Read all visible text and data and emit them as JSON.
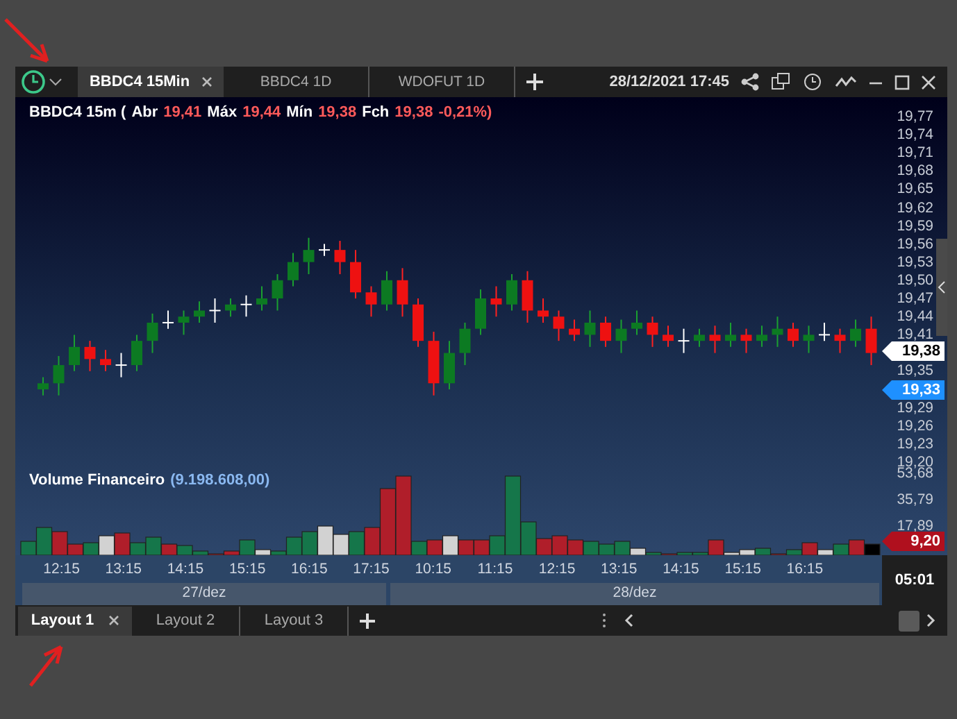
{
  "window": {
    "tabs": [
      {
        "label": "BBDC4 15Min",
        "selected": true
      },
      {
        "label": "BBDC4 1D",
        "selected": false
      },
      {
        "label": "WDOFUT 1D",
        "selected": false
      }
    ],
    "datetime": "28/12/2021 17:45"
  },
  "chart": {
    "legend": {
      "title": "BBDC4 15m (",
      "items": [
        {
          "label": "Abr",
          "value": "19,41"
        },
        {
          "label": "Máx",
          "value": "19,44"
        },
        {
          "label": "Mín",
          "value": "19,38"
        },
        {
          "label": "Fch",
          "value": "19,38"
        }
      ],
      "change": "-0,21%)"
    },
    "price_axis": [
      "19,77",
      "19,74",
      "19,71",
      "19,68",
      "19,65",
      "19,62",
      "19,59",
      "19,56",
      "19,53",
      "19,50",
      "19,47",
      "19,44",
      "19,41",
      "19,35",
      "19,29",
      "19,26",
      "19,23",
      "19,20"
    ],
    "last_price": "19,38",
    "bid_price": "19,33",
    "volume": {
      "title": "Volume Financeiro",
      "value": "(9.198.608,00)",
      "axis": [
        "53,68",
        "35,79",
        "17,89"
      ],
      "last": "9,20"
    },
    "time_labels": [
      "12:15",
      "13:15",
      "14:15",
      "15:15",
      "16:15",
      "17:15",
      "10:15",
      "11:15",
      "12:15",
      "13:15",
      "14:15",
      "15:15",
      "16:15"
    ],
    "dates": [
      "27/dez",
      "28/dez"
    ],
    "countdown": "05:01"
  },
  "layouts": [
    {
      "label": "Layout 1",
      "selected": true
    },
    {
      "label": "Layout 2",
      "selected": false
    },
    {
      "label": "Layout 3",
      "selected": false
    }
  ]
}
